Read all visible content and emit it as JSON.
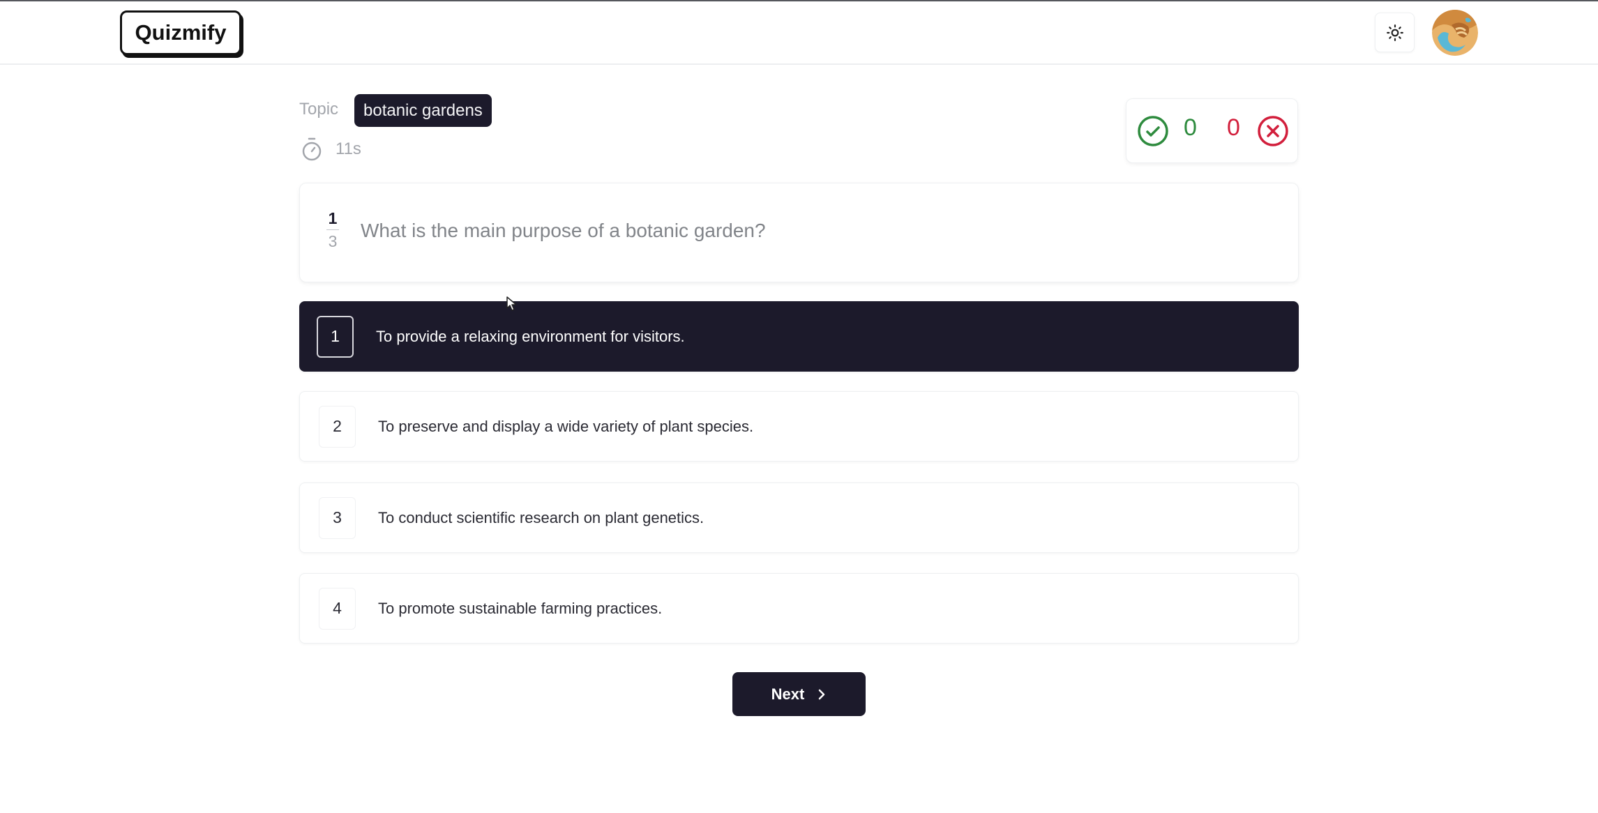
{
  "header": {
    "logo": "Quizmify",
    "theme_toggle_icon": "sun-icon",
    "avatar_icon": "user-avatar"
  },
  "quiz": {
    "topic_label": "Topic",
    "topic": "botanic gardens",
    "timer_icon": "timer-icon",
    "elapsed": "11s",
    "score": {
      "correct": "0",
      "wrong": "0",
      "correct_color": "#2e8b3e",
      "wrong_color": "#d21f3c"
    },
    "question": {
      "current": "1",
      "total": "3",
      "text": "What is the main purpose of a botanic garden?"
    },
    "options": [
      {
        "number": "1",
        "text": "To provide a relaxing environment for visitors.",
        "selected": true
      },
      {
        "number": "2",
        "text": "To preserve and display a wide variety of plant species.",
        "selected": false
      },
      {
        "number": "3",
        "text": "To conduct scientific research on plant genetics.",
        "selected": false
      },
      {
        "number": "4",
        "text": "To promote sustainable farming practices.",
        "selected": false
      }
    ],
    "next_label": "Next",
    "accent_color": "#1c1a2b"
  }
}
